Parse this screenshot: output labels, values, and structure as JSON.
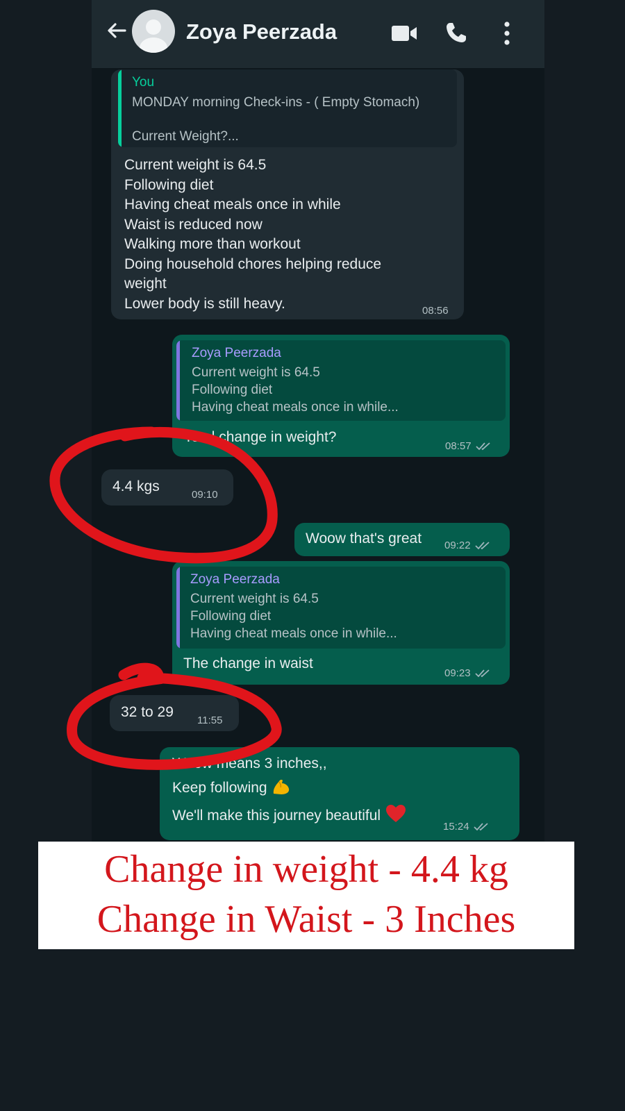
{
  "header": {
    "contact_name": "Zoya Peerzada",
    "icons": [
      "back-arrow-icon",
      "avatar-placeholder",
      "video-call-icon",
      "voice-call-icon",
      "more-options-icon"
    ]
  },
  "messages": [
    {
      "direction": "in",
      "quote": {
        "author": "You",
        "lines": [
          "MONDAY morning Check-ins - ( Empty Stomach)",
          "",
          "Current Weight?..."
        ]
      },
      "text": "Current weight is 64.5\nFollowing diet\nHaving cheat meals once in while\nWaist is reduced now\nWalking more than workout\nDoing household chores helping reduce\nweight\nLower body is still heavy.",
      "time": "08:56"
    },
    {
      "direction": "out",
      "quote": {
        "author": "Zoya Peerzada",
        "lines": [
          "Current weight is 64.5",
          "Following diet",
          "Having cheat meals once in while..."
        ]
      },
      "text": "Total change in weight?",
      "time": "08:57"
    },
    {
      "direction": "in",
      "text": "4.4 kgs",
      "time": "09:10"
    },
    {
      "direction": "out",
      "text": "Woow that's great",
      "time": "09:22"
    },
    {
      "direction": "out",
      "quote": {
        "author": "Zoya Peerzada",
        "lines": [
          "Current weight is 64.5",
          "Following diet",
          "Having cheat meals once in while..."
        ]
      },
      "text": "The change in waist",
      "time": "09:23"
    },
    {
      "direction": "in",
      "text": "32 to 29",
      "time": "11:55"
    },
    {
      "direction": "out",
      "lines": [
        "Woow means 3 inches,,",
        "Keep following",
        "We'll make this journey beautiful"
      ],
      "emojis": [
        "flexed-biceps-emoji",
        "red-heart-emoji"
      ],
      "time": "15:24"
    }
  ],
  "annotation": {
    "line1": "Change in weight - 4.4 kg",
    "line2": "Change in Waist - 3 Inches"
  },
  "colors": {
    "incoming_bubble": "#202c33",
    "outgoing_bubble": "#055e4d",
    "annotation_red": "#d3161c",
    "highlight_circle": "#e0151b"
  }
}
